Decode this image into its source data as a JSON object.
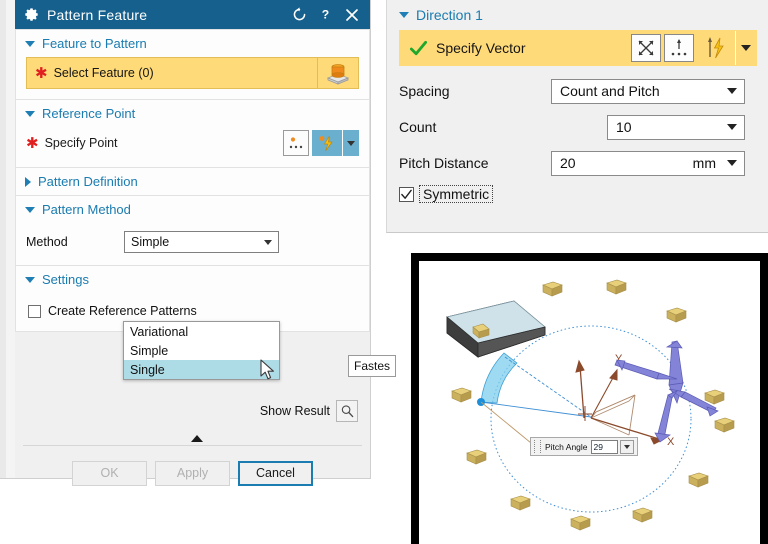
{
  "dialog": {
    "title": "Pattern Feature",
    "title_icons": [
      {
        "name": "reset-icon",
        "glyph": "↺"
      },
      {
        "name": "help-icon",
        "glyph": "?"
      },
      {
        "name": "close-icon",
        "glyph": "✕"
      }
    ],
    "sections": {
      "feature_to_pattern": {
        "label": "Feature to Pattern",
        "expanded": true,
        "select_feature_label": "Select Feature (0)",
        "required_marker": "✱",
        "feature_icon": "boss-pad-icon"
      },
      "reference_point": {
        "label": "Reference Point",
        "expanded": true,
        "specify_point_label": "Specify Point",
        "required_marker": "✱",
        "buttons": [
          "point-dialog-icon",
          "point-inference-icon",
          "inference-dropdown-icon"
        ]
      },
      "pattern_definition": {
        "label": "Pattern Definition",
        "expanded": false
      },
      "pattern_method": {
        "label": "Pattern Method",
        "expanded": true,
        "method_label": "Method",
        "method_value": "Simple",
        "method_options": [
          "Variational",
          "Simple",
          "Single"
        ],
        "method_highlighted": "Single",
        "tooltip": "Fastes"
      },
      "settings": {
        "label": "Settings",
        "expanded": true,
        "create_reference_patterns_label": "Create Reference Patterns",
        "create_reference_patterns_checked": false
      }
    },
    "show_result_label": "Show Result",
    "show_result_icon": "magnifier-icon",
    "buttons": {
      "ok": "OK",
      "apply": "Apply",
      "cancel": "Cancel"
    }
  },
  "direction_panel": {
    "header": "Direction 1",
    "expanded": true,
    "specify_vector_label": "Specify Vector",
    "specify_vector_status": "check-green-icon",
    "vector_buttons": [
      "vector-cross-icon",
      "vector-point-icon",
      "vector-inference-icon",
      "vector-dropdown-icon"
    ],
    "rows": [
      {
        "label": "Spacing",
        "value": "Count and Pitch",
        "unit": ""
      },
      {
        "label": "Count",
        "value": "10",
        "unit": ""
      },
      {
        "label": "Pitch Distance",
        "value": "20",
        "unit": "mm"
      }
    ],
    "symmetric_label": "Symmetric",
    "symmetric_checked": true
  },
  "viewport": {
    "pitch_angle_label": "Pitch Angle",
    "pitch_angle_value": "29",
    "axis_labels": {
      "x": "X",
      "y": "Y"
    },
    "instance_count": 12
  },
  "colors": {
    "titlebar": "#15608c",
    "section_heading": "#1a7cb0",
    "select_highlight": "#ffda79",
    "option_highlight": "#addbe6",
    "required_star": "#e02020",
    "accent_button": "#1a7cb0",
    "inference_blue": "#6aafcd"
  }
}
